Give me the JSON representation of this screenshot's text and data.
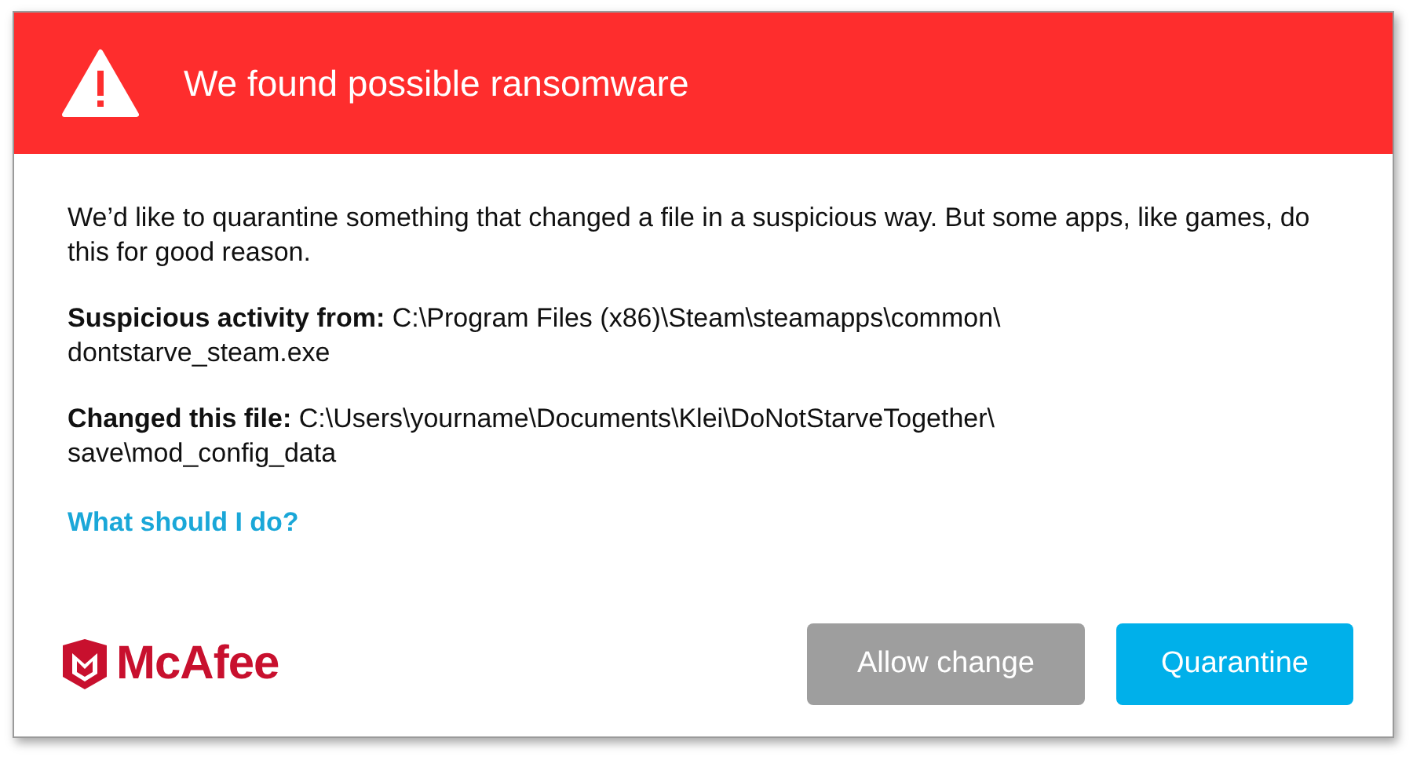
{
  "header": {
    "title": "We found possible ransomware"
  },
  "message": "We’d like to quarantine something that changed a file in a suspicious way. But some apps, like games, do this for good reason.",
  "details": [
    {
      "label": "Suspicious activity from:",
      "lines": [
        "C:\\Program Files (x86)\\Steam\\steamapps\\common\\",
        "dontstarve_steam.exe"
      ]
    },
    {
      "label": "Changed this file:",
      "lines": [
        "C:\\Users\\yourname\\Documents\\Klei\\DoNotStarveTogether\\",
        "save\\mod_config_data"
      ]
    }
  ],
  "help_link": "What should I do?",
  "logo": {
    "text": "McAfee"
  },
  "buttons": [
    {
      "label": "Allow change",
      "kind": "secondary"
    },
    {
      "label": "Quarantine",
      "kind": "primary"
    }
  ]
}
